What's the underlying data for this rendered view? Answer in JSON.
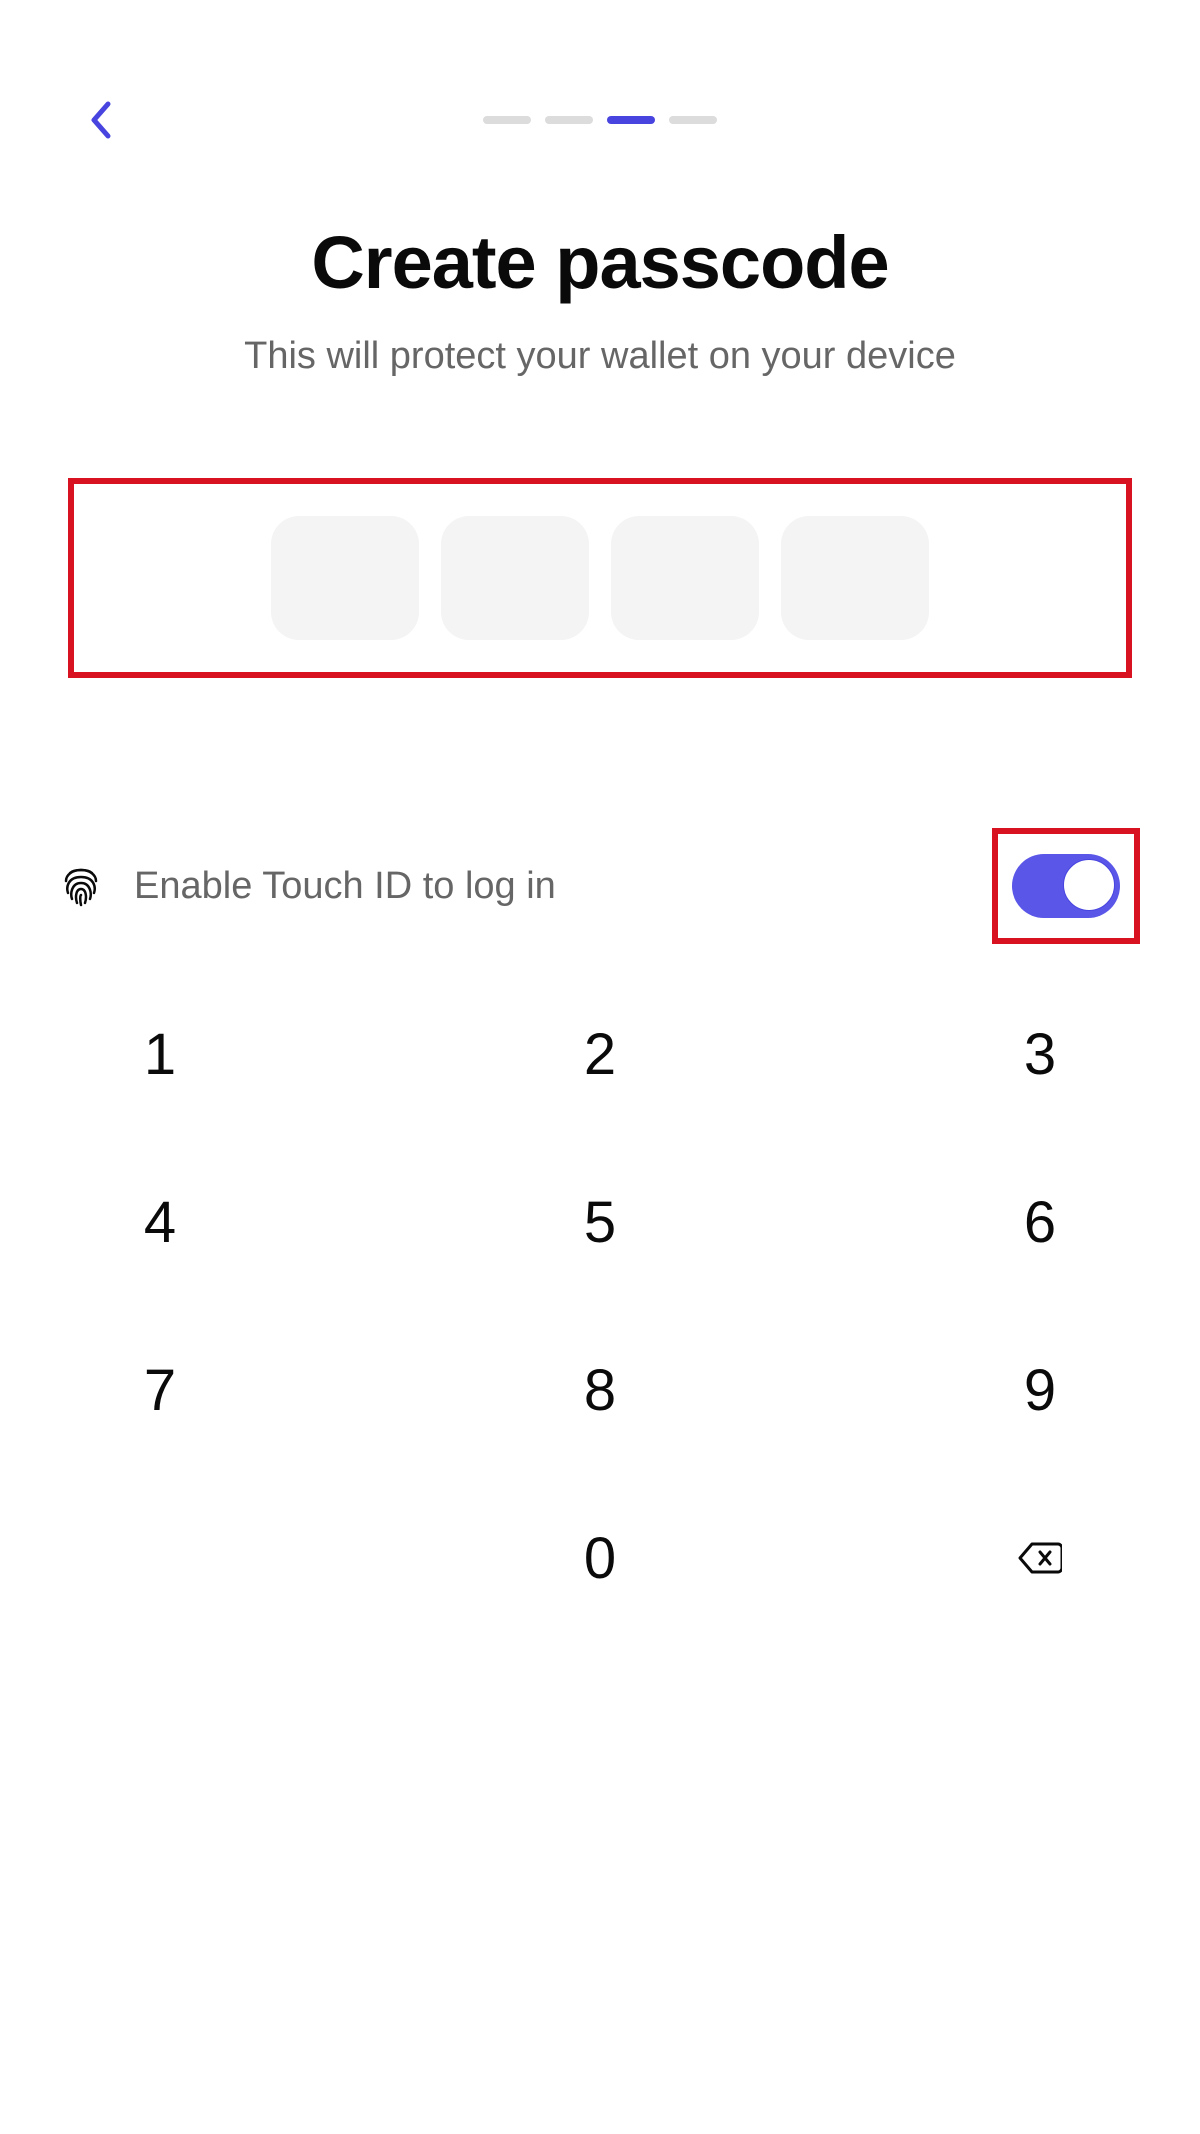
{
  "header": {
    "progress_step": 3,
    "progress_total": 4
  },
  "title": "Create passcode",
  "subtitle": "This will protect your wallet on your device",
  "passcode": {
    "length": 4,
    "filled": 0
  },
  "touch_id": {
    "label": "Enable Touch ID to log in",
    "enabled": true
  },
  "keypad": {
    "keys": [
      "1",
      "2",
      "3",
      "4",
      "5",
      "6",
      "7",
      "8",
      "9",
      "",
      "0",
      "backspace"
    ]
  },
  "highlights": {
    "passcode_box": true,
    "toggle": true
  },
  "colors": {
    "accent": "#4844e0",
    "highlight_border": "#d81220",
    "inactive": "#dcdcdc",
    "text_primary": "#0a0a0a",
    "text_secondary": "#666666"
  }
}
